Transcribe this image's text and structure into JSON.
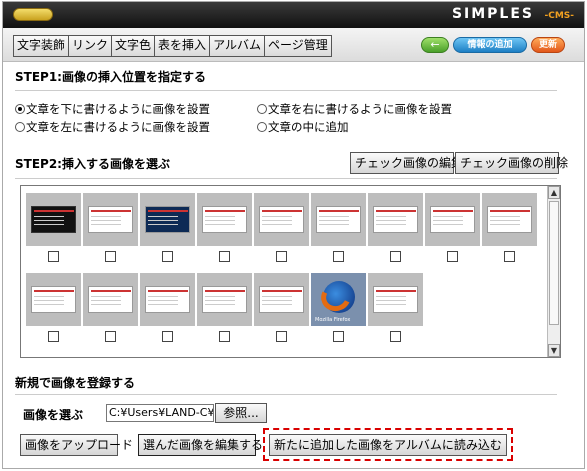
{
  "brand": {
    "name": "SIMPLES",
    "sub": "-CMS-"
  },
  "toolbar": {
    "menu": [
      "文字装飾",
      "リンク",
      "文字色",
      "表を挿入",
      "アルバム",
      "ページ管理"
    ],
    "back_label": "←",
    "add_info_label": "情報の追加",
    "update_label": "更新"
  },
  "step1": {
    "title": "STEP1:画像の挿入位置を指定する",
    "options": [
      "文章を下に書けるように画像を設置",
      "文章を右に書けるように画像を設置",
      "文章を左に書けるように画像を設置",
      "文章の中に追加"
    ],
    "selected_index": 0
  },
  "step2": {
    "title": "STEP2:挿入する画像を選ぶ",
    "edit_checked_label": "チェック画像の編集",
    "delete_checked_label": "チェック画像の削除",
    "thumbnails_row1": [
      "dark",
      "light",
      "blue",
      "page",
      "page",
      "page",
      "page",
      "page",
      "light"
    ],
    "thumbnails_row2": [
      "page",
      "page",
      "page",
      "page",
      "page",
      "firefox",
      "light"
    ],
    "firefox_caption": "Mozilla Firefox"
  },
  "register": {
    "title": "新規で画像を登録する",
    "choose_label": "画像を選ぶ",
    "file_value": "C:¥Users¥LAND-C¥",
    "browse_label": "参照...",
    "upload_label": "画像をアップロード",
    "edit_selected_label": "選んだ画像を編集する",
    "load_album_label": "新たに追加した画像をアルバムに読み込む"
  }
}
